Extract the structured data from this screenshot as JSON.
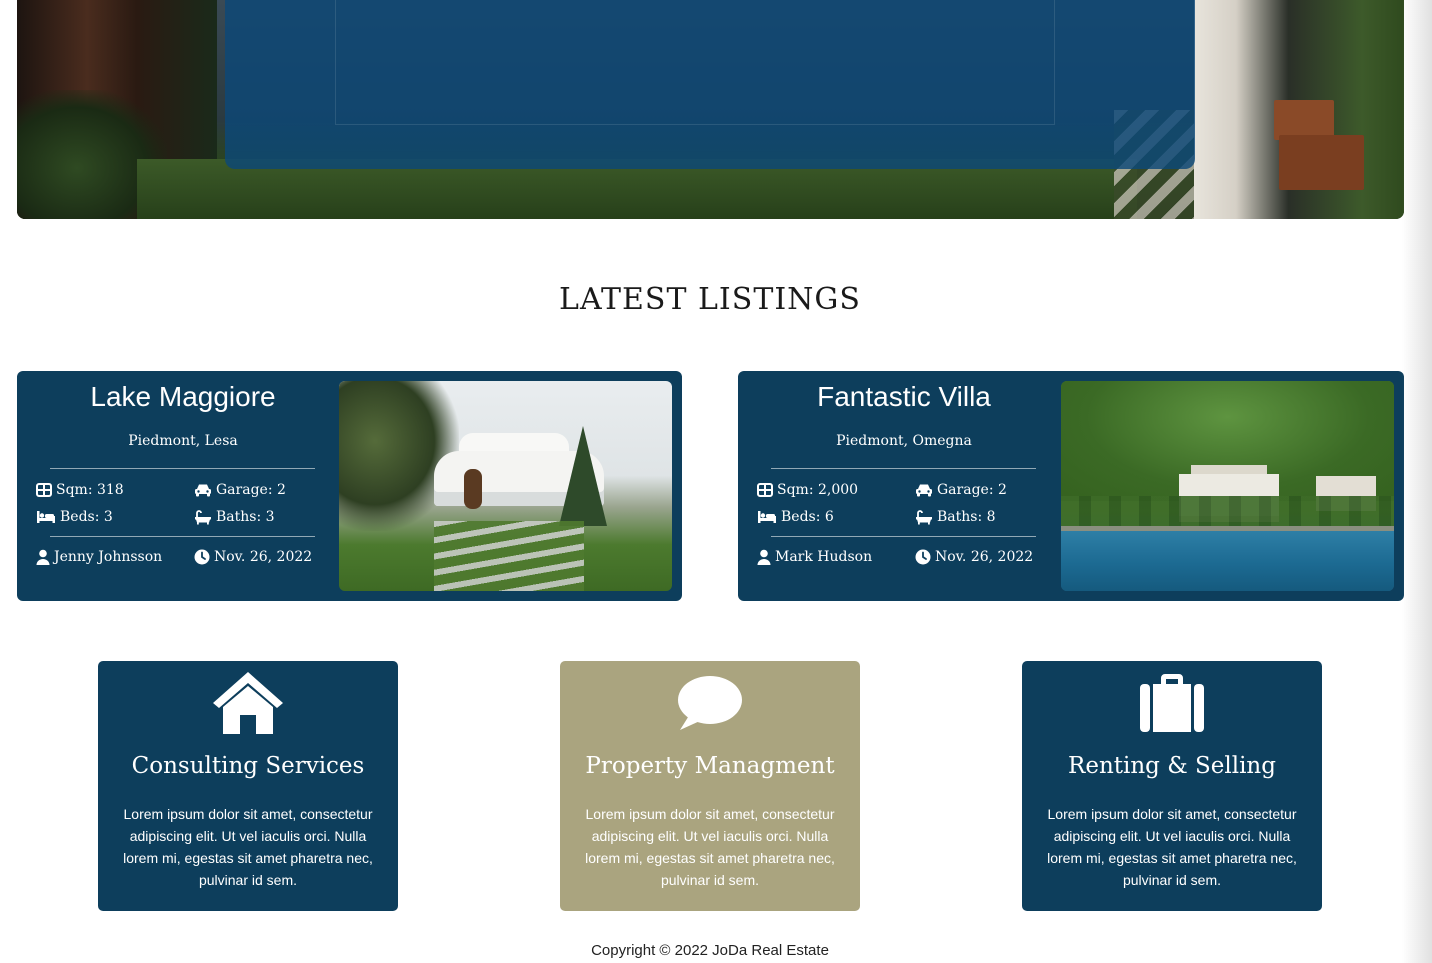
{
  "section_title": "LATEST LISTINGS",
  "listings": [
    {
      "title": "Lake Maggiore",
      "location": "Piedmont, Lesa",
      "sqm": "Sqm: 318",
      "garage": "Garage: 2",
      "beds": "Beds: 3",
      "baths": "Baths: 3",
      "agent": "Jenny Johnsson",
      "date": "Nov. 26, 2022"
    },
    {
      "title": "Fantastic Villa",
      "location": "Piedmont, Omegna",
      "sqm": "Sqm: 2,000",
      "garage": "Garage: 2",
      "beds": "Beds: 6",
      "baths": "Baths: 8",
      "agent": "Mark Hudson",
      "date": "Nov. 26, 2022"
    }
  ],
  "services": [
    {
      "icon": "home-icon",
      "title": "Consulting Services",
      "description": "Lorem ipsum dolor sit amet, consectetur adipiscing elit. Ut vel iaculis orci. Nulla lorem mi, egestas sit amet pharetra nec, pulvinar id sem."
    },
    {
      "icon": "comment-icon",
      "title": "Property Managment",
      "description": "Lorem ipsum dolor sit amet, consectetur adipiscing elit. Ut vel iaculis orci. Nulla lorem mi, egestas sit amet pharetra nec, pulvinar id sem."
    },
    {
      "icon": "suitcase-icon",
      "title": "Renting & Selling",
      "description": "Lorem ipsum dolor sit amet, consectetur adipiscing elit. Ut vel iaculis orci. Nulla lorem mi, egestas sit amet pharetra nec, pulvinar id sem."
    }
  ],
  "footer": {
    "copyright": "Copyright © 2022 JoDa Real Estate"
  },
  "colors": {
    "primary": "#0d3e5c",
    "accent": "#aaa47f",
    "hero_overlay": "#0c4878"
  }
}
